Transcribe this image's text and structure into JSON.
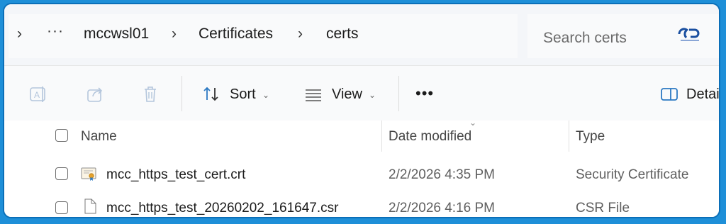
{
  "breadcrumb": {
    "overflow": "···",
    "items": [
      "mccwsl01",
      "Certificates",
      "certs"
    ]
  },
  "search": {
    "placeholder": "Search certs"
  },
  "toolbar": {
    "sort_label": "Sort",
    "view_label": "View",
    "more_label": "•••",
    "details_label": "Detail"
  },
  "columns": {
    "name": "Name",
    "date": "Date modified",
    "type": "Type"
  },
  "files": [
    {
      "name": "mcc_https_test_cert.crt",
      "date": "2/2/2026 4:35 PM",
      "type": "Security Certificate",
      "icon": "certificate-file-icon"
    },
    {
      "name": "mcc_https_test_20260202_161647.csr",
      "date": "2/2/2026 4:16 PM",
      "type": "CSR File",
      "icon": "generic-file-icon"
    }
  ],
  "colors": {
    "border": "#0b6fb8",
    "outer": "#1e8fd8",
    "accent": "#2b78c2"
  }
}
